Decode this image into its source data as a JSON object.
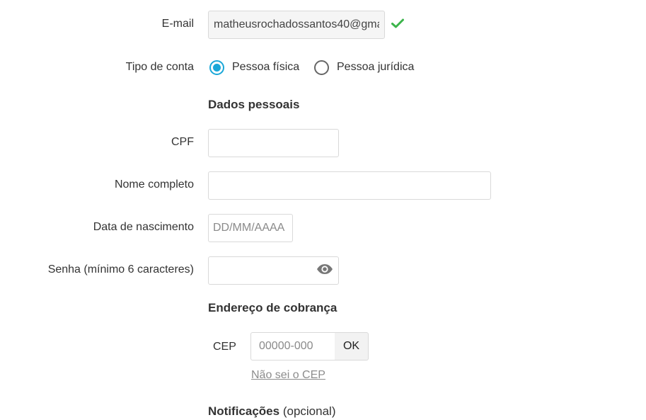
{
  "form": {
    "email": {
      "label": "E-mail",
      "value": "matheusrochadossantos40@gma"
    },
    "account_type": {
      "label": "Tipo de conta",
      "options": [
        {
          "label": "Pessoa física",
          "selected": true
        },
        {
          "label": "Pessoa jurídica",
          "selected": false
        }
      ]
    },
    "personal": {
      "title": "Dados pessoais",
      "cpf_label": "CPF",
      "name_label": "Nome completo",
      "birth_label": "Data de nascimento",
      "birth_placeholder": "DD/MM/AAAA",
      "password_label": "Senha (mínimo 6 caracteres)"
    },
    "billing": {
      "title": "Endereço de cobrança",
      "cep_label": "CEP",
      "cep_placeholder": "00000-000",
      "ok_label": "OK",
      "cep_link": "Não sei o CEP"
    },
    "notifications": {
      "title": "Notificações",
      "optional": "(opcional)"
    }
  },
  "icons": {
    "valid": "check-icon",
    "password_toggle": "eye-icon"
  },
  "colors": {
    "accent": "#1aa7d8",
    "valid": "#3cb44b",
    "link": "#8c8c8c"
  }
}
